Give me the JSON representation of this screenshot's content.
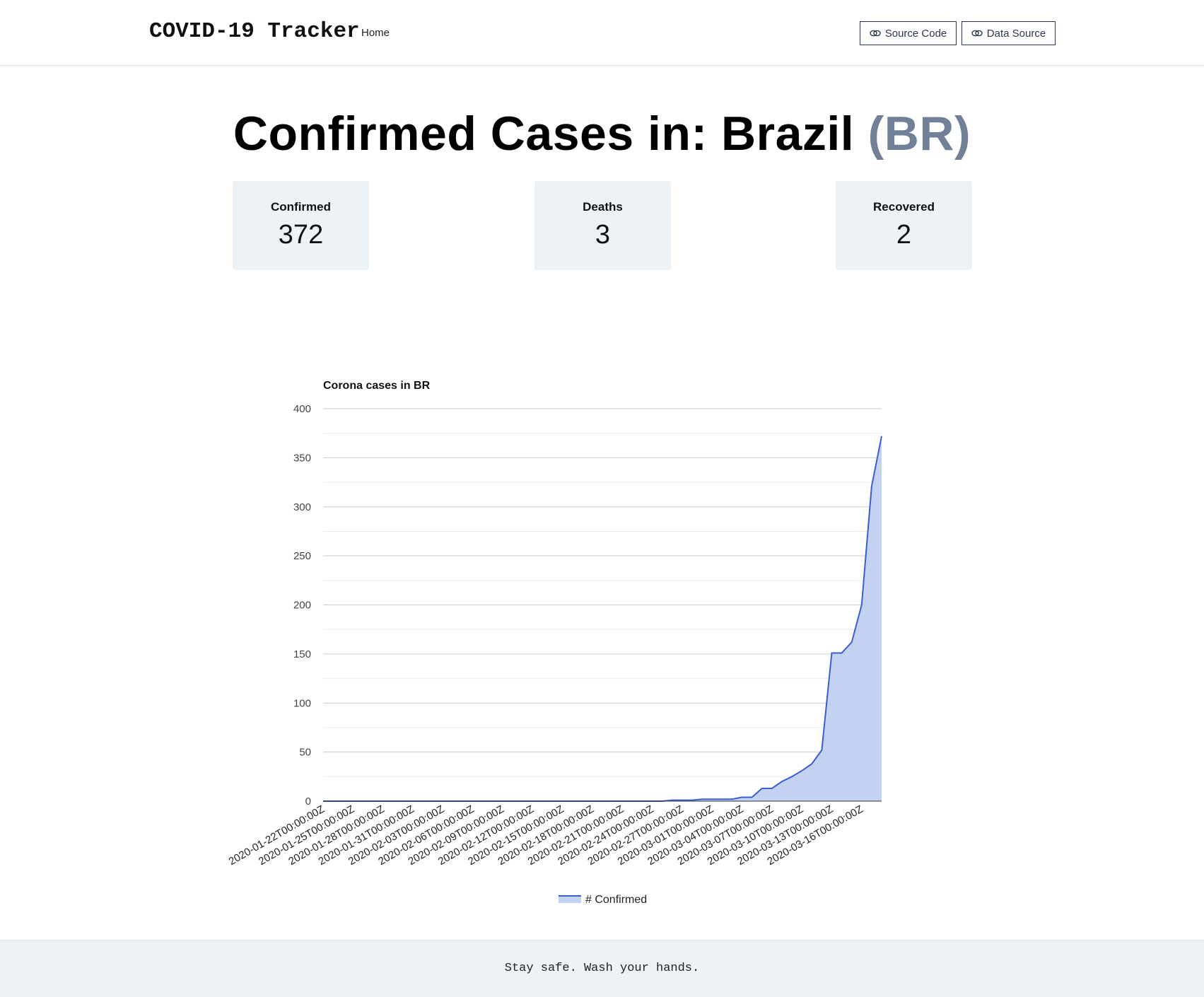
{
  "navbar": {
    "brand": "COVID-19 Tracker",
    "home_link": "Home",
    "source_code_button": "Source Code",
    "data_source_button": "Data Source",
    "button_icon": "link-icon"
  },
  "header": {
    "title_prefix": "Confirmed Cases in: Brazil",
    "country_code": "(BR)",
    "code_color": "#718096"
  },
  "stats": [
    {
      "label": "Confirmed",
      "value": "372"
    },
    {
      "label": "Deaths",
      "value": "3"
    },
    {
      "label": "Recovered",
      "value": "2"
    }
  ],
  "footer": {
    "text": "Stay safe. Wash your hands."
  },
  "chart_data": {
    "type": "area",
    "title": "Corona cases in BR",
    "xlabel": "",
    "ylabel": "",
    "ylim": [
      0,
      400
    ],
    "y_ticks": [
      0,
      50,
      100,
      150,
      200,
      250,
      300,
      350,
      400
    ],
    "grid": true,
    "legend_position": "bottom",
    "line_color": "#3b5fcf",
    "fill_color": "#c3d2f0",
    "x_tick_labels": [
      "2020-01-22T00:00:00Z",
      "2020-01-25T00:00:00Z",
      "2020-01-28T00:00:00Z",
      "2020-01-31T00:00:00Z",
      "2020-02-03T00:00:00Z",
      "2020-02-06T00:00:00Z",
      "2020-02-09T00:00:00Z",
      "2020-02-12T00:00:00Z",
      "2020-02-15T00:00:00Z",
      "2020-02-18T00:00:00Z",
      "2020-02-21T00:00:00Z",
      "2020-02-24T00:00:00Z",
      "2020-02-27T00:00:00Z",
      "2020-03-01T00:00:00Z",
      "2020-03-04T00:00:00Z",
      "2020-03-07T00:00:00Z",
      "2020-03-10T00:00:00Z",
      "2020-03-13T00:00:00Z",
      "2020-03-16T00:00:00Z"
    ],
    "x_start": "2020-01-22",
    "x_end": "2020-03-18",
    "series": [
      {
        "name": "# Confirmed",
        "values": [
          0,
          0,
          0,
          0,
          0,
          0,
          0,
          0,
          0,
          0,
          0,
          0,
          0,
          0,
          0,
          0,
          0,
          0,
          0,
          0,
          0,
          0,
          0,
          0,
          0,
          0,
          0,
          0,
          0,
          0,
          0,
          0,
          0,
          0,
          0,
          1,
          1,
          1,
          2,
          2,
          2,
          2,
          4,
          4,
          13,
          13,
          20,
          25,
          31,
          38,
          52,
          151,
          151,
          162,
          200,
          321,
          372
        ]
      }
    ]
  }
}
